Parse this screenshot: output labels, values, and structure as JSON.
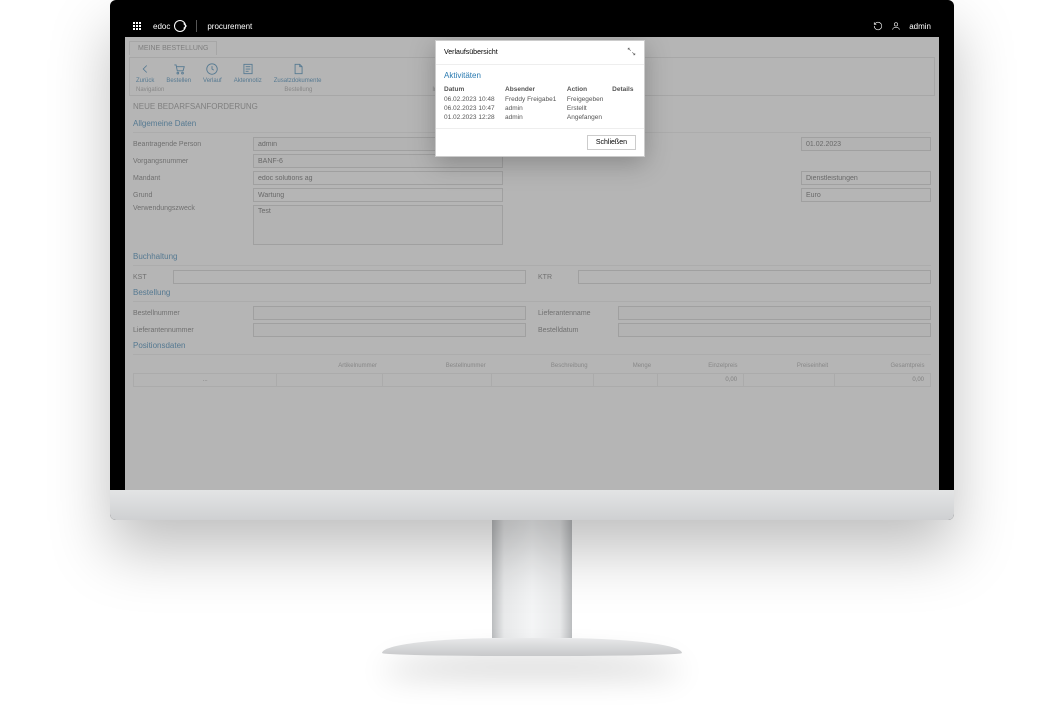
{
  "header": {
    "brand": "edoc",
    "module": "procurement",
    "user": "admin"
  },
  "breadcrumb": {
    "tab": "MEINE BESTELLUNG"
  },
  "toolbar": {
    "items": [
      {
        "label": "Zurück",
        "icon": "back"
      },
      {
        "label": "Bestellen",
        "icon": "cart"
      },
      {
        "label": "Verlauf",
        "icon": "history"
      },
      {
        "label": "Aktennotiz",
        "icon": "note"
      },
      {
        "label": "Zusatzdokumente",
        "icon": "doc"
      }
    ],
    "groups": [
      "Navigation",
      "Bestellung",
      "Information"
    ]
  },
  "page_title": "NEUE BEDARFSANFORDERUNG",
  "sections": {
    "general": {
      "title": "Allgemeine Daten",
      "fields": {
        "requester_label": "Beantragende Person",
        "requester_value": "admin",
        "date_value": "01.02.2023",
        "vorgang_label": "Vorgangsnummer",
        "vorgang_value": "BANF-6",
        "mandant_label": "Mandant",
        "mandant_value": "edoc solutions ag",
        "type_value": "Dienstleistungen",
        "grund_label": "Grund",
        "grund_value": "Wartung",
        "currency_value": "Euro",
        "zweck_label": "Verwendungszweck",
        "zweck_value": "Test"
      }
    },
    "accounting": {
      "title": "Buchhaltung",
      "kst_label": "KST",
      "ktr_label": "KTR"
    },
    "order": {
      "title": "Bestellung",
      "bestellnr_label": "Bestellnummer",
      "liefname_label": "Lieferantenname",
      "liefnr_label": "Lieferantennummer",
      "bestelldatum_label": "Bestelldatum"
    },
    "positions": {
      "title": "Positionsdaten",
      "cols": [
        "",
        "Artikelnummer",
        "Bestellnummer",
        "Beschreibung",
        "Menge",
        "Einzelpreis",
        "Preiseinheit",
        "Gesamtpreis"
      ],
      "row": {
        "dots": "...",
        "einzelpreis": "0,00",
        "gesamt": "0,00"
      }
    }
  },
  "dialog": {
    "title": "Verlaufsübersicht",
    "subtitle": "Aktivitäten",
    "cols": {
      "datum": "Datum",
      "absender": "Absender",
      "action": "Action",
      "details": "Details"
    },
    "rows": [
      {
        "datum": "06.02.2023 10:48",
        "absender": "Freddy Freigabe1",
        "action": "Freigegeben"
      },
      {
        "datum": "06.02.2023 10:47",
        "absender": "admin",
        "action": "Erstellt"
      },
      {
        "datum": "01.02.2023 12:28",
        "absender": "admin",
        "action": "Angefangen"
      }
    ],
    "close": "Schließen"
  }
}
